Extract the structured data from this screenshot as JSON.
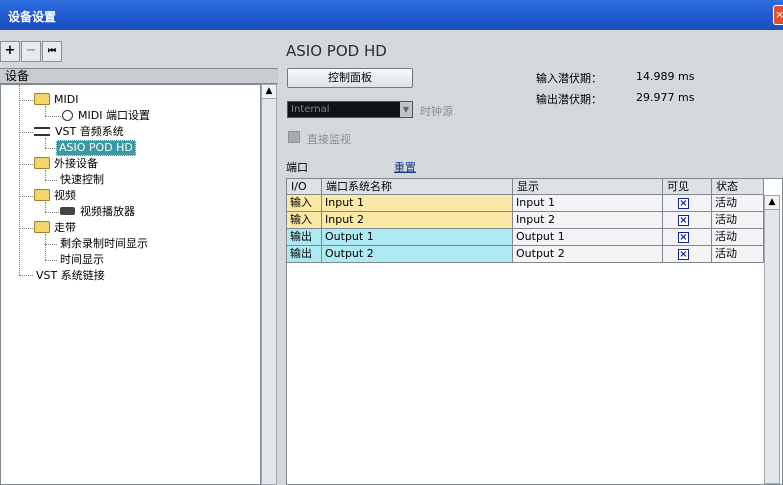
{
  "window": {
    "title": "设备设置",
    "close_glyph": "×"
  },
  "toolbar": {
    "add": "+",
    "remove": "−",
    "reset_glyph": "⏮"
  },
  "left": {
    "header": "设备",
    "tree": {
      "midi": "MIDI",
      "midi_port_settings": "MIDI 端口设置",
      "vst_audio": "VST 音频系统",
      "asio_pod": "ASIO POD HD",
      "ext_devices": "外接设备",
      "quick_control": "快速控制",
      "video": "视频",
      "video_player": "视频播放器",
      "transport": "走带",
      "remaining_time": "剩余录制时间显示",
      "time_display": "时间显示",
      "vst_link": "VST 系统链接"
    }
  },
  "right": {
    "title": "ASIO POD HD",
    "control_panel_button": "控制面板",
    "input_latency_label": "输入潜伏期：",
    "input_latency_value": "14.989 ms",
    "output_latency_label": "输出潜伏期：",
    "output_latency_value": "29.977 ms",
    "clock_select_value": "Internal",
    "clock_source_label": "时钟源",
    "direct_monitor_label": "直接监视",
    "ports_label": "端口",
    "reset_link": "重置"
  },
  "table": {
    "headers": {
      "io": "I/O",
      "name": "端口系统名称",
      "display": "显示",
      "visible": "可见",
      "state": "状态"
    },
    "rows": [
      {
        "io": "输入",
        "name": "Input 1",
        "display": "Input 1",
        "visible": "×",
        "state": "活动"
      },
      {
        "io": "输入",
        "name": "Input 2",
        "display": "Input 2",
        "visible": "×",
        "state": "活动"
      },
      {
        "io": "输出",
        "name": "Output 1",
        "display": "Output 1",
        "visible": "×",
        "state": "活动"
      },
      {
        "io": "输出",
        "name": "Output 2",
        "display": "Output 2",
        "visible": "×",
        "state": "活动"
      }
    ]
  },
  "colors": {
    "input_row": "#fbe9a8",
    "output_row": "#aeeaf4",
    "titlebar": "#2f6fe0",
    "selected": "#3a99a4"
  },
  "icons": {
    "folder": "folder-icon",
    "midi_port": "midi-port-icon",
    "audio": "audio-system-icon",
    "video_player": "video-player-icon",
    "scroll_up": "scroll-up-icon"
  }
}
